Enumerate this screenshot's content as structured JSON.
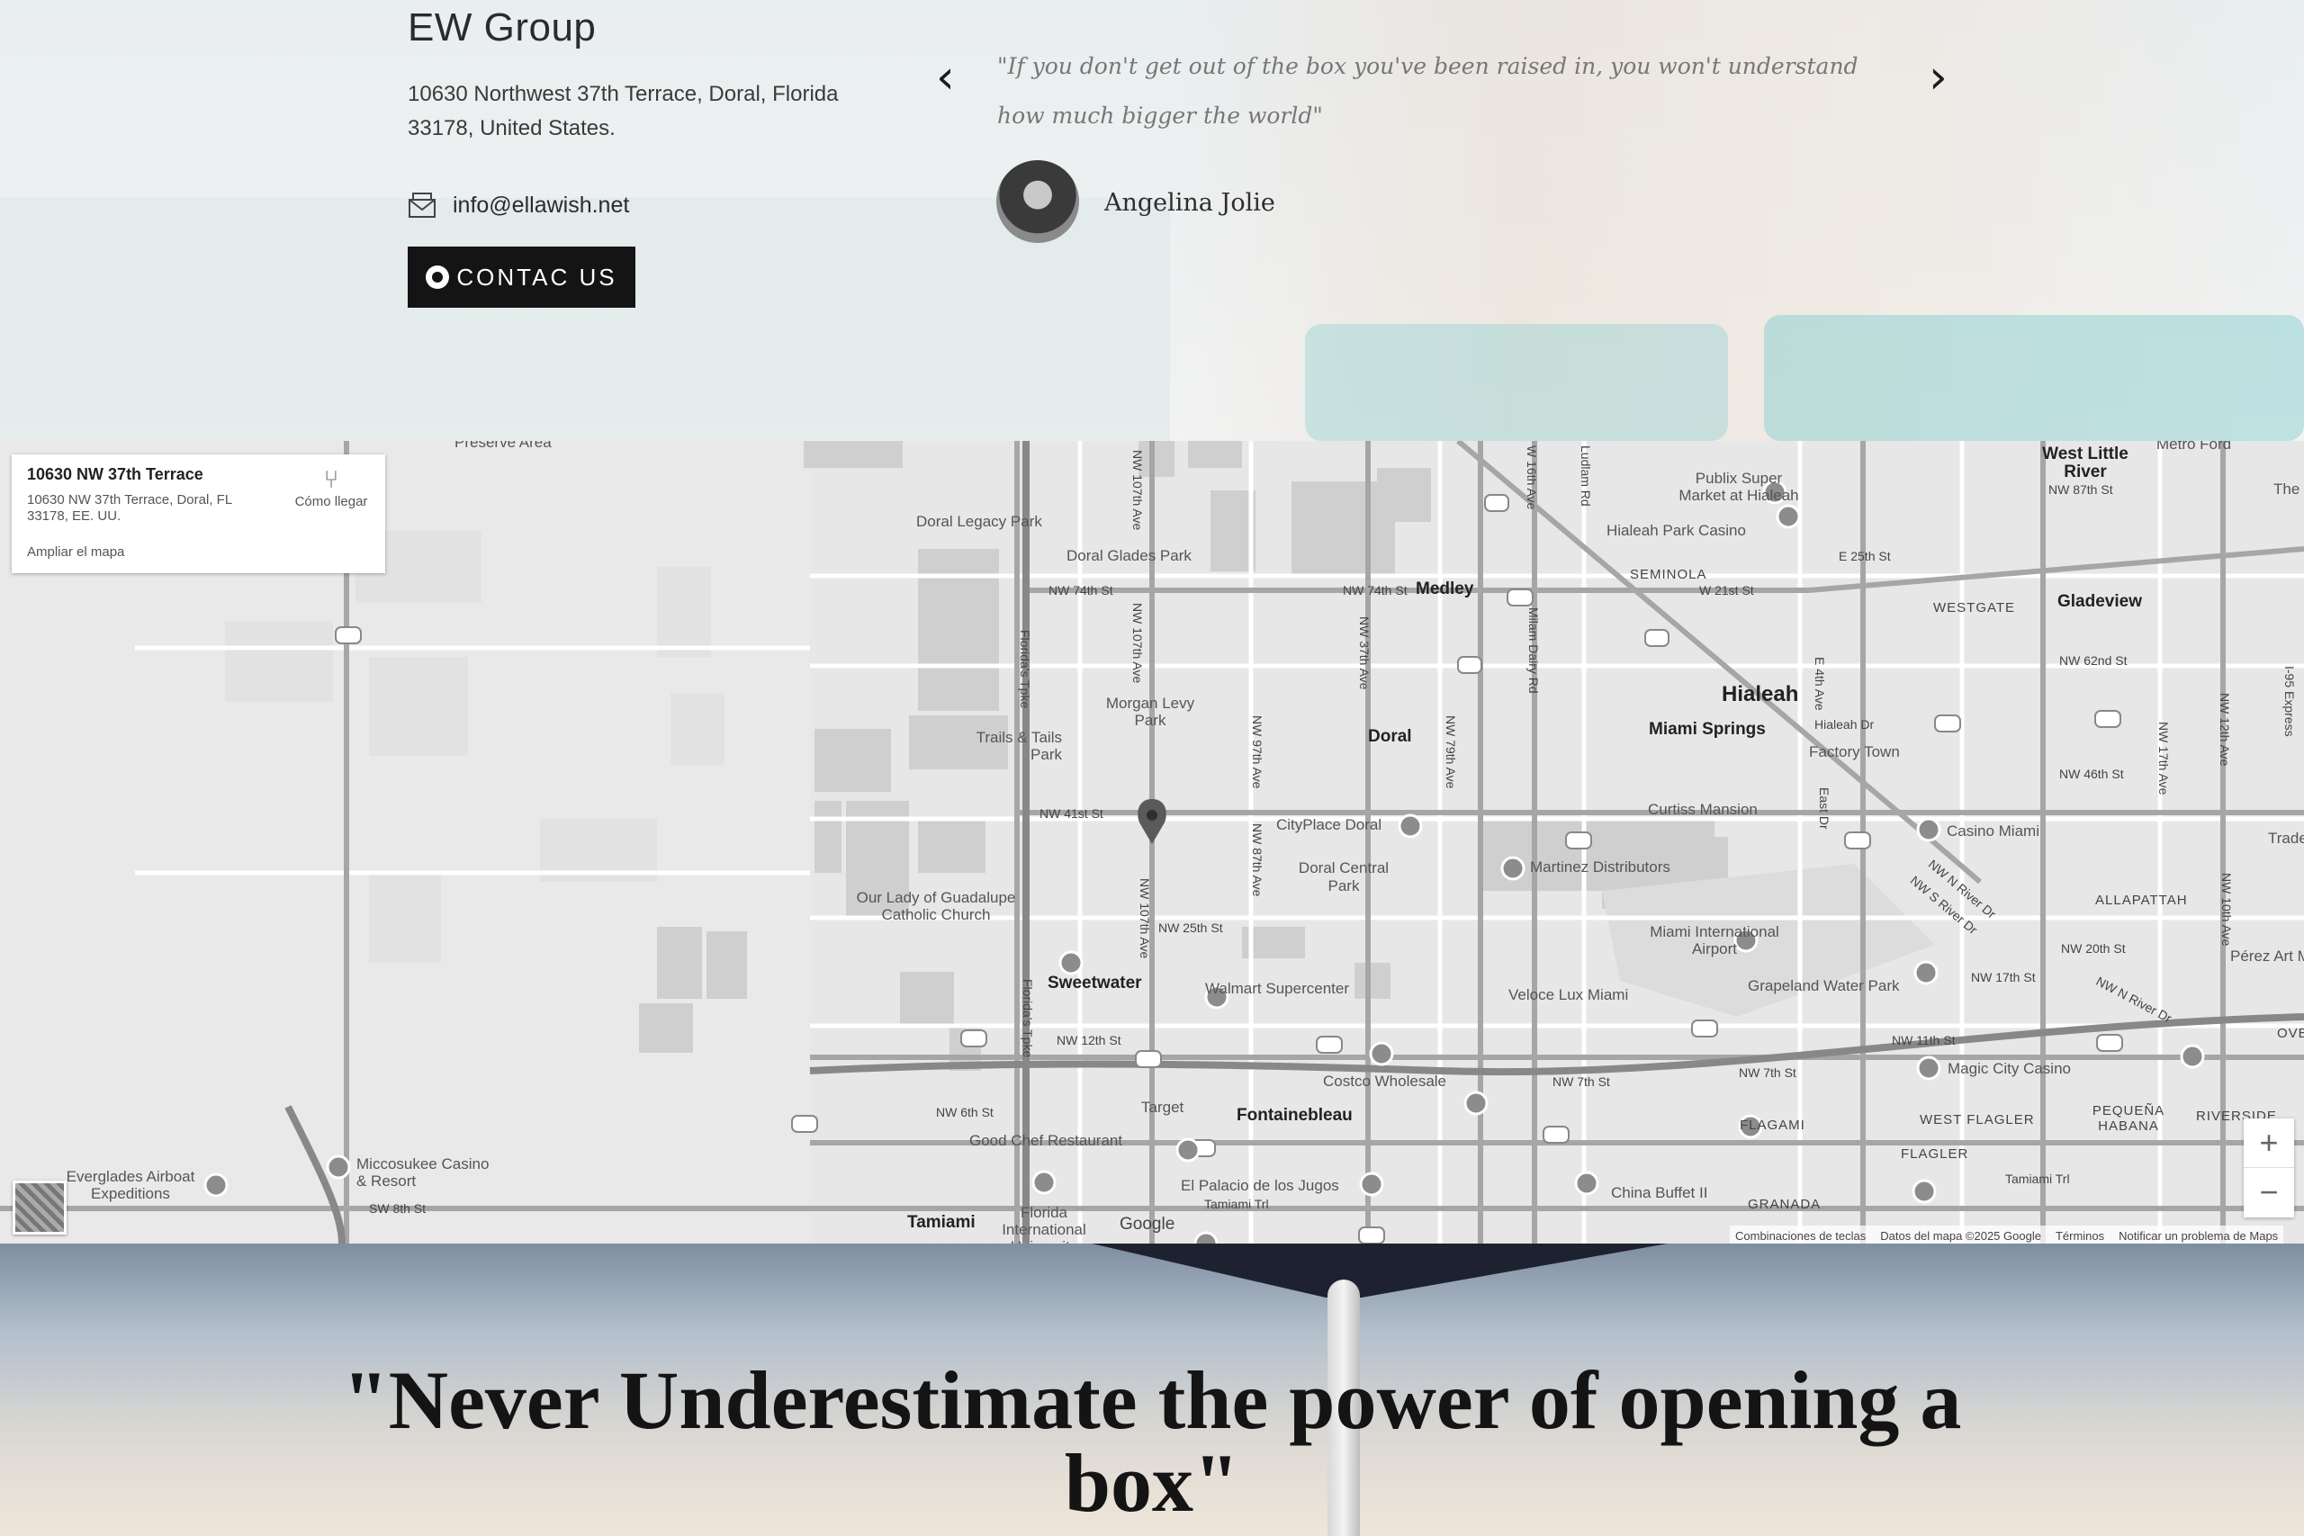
{
  "contact": {
    "company": "EW Group",
    "address": "10630 Northwest 37th Terrace, Doral, Florida 33178, United States.",
    "email": "info@ellawish.net",
    "cta_label": "CONTAC US"
  },
  "testimonial": {
    "quote": "\"If you don't get out of the box you've been raised in, you won't understand how much bigger the world\"",
    "author": "Angelina Jolie"
  },
  "map": {
    "card": {
      "title": "10630 NW 37th Terrace",
      "address": "10630 NW 37th Terrace, Doral, FL 33178, EE. UU.",
      "directions": "Cómo llegar",
      "enlarge": "Ampliar el mapa"
    },
    "labels": {
      "doral_legacy_park": "Doral Legacy Park",
      "doral_glades_park": "Doral Glades Park",
      "nw_74th_st": "NW 74th St",
      "nw_74th_st_2": "NW 74th St",
      "medley": "Medley",
      "publix": "Publix Super Market at Hialeah",
      "hialeah_park_casino": "Hialeah Park Casino",
      "seminola": "SEMINOLA",
      "w_21st_st": "W 21st St",
      "e_25th_st": "E 25th St",
      "westgate": "WESTGATE",
      "gladeview": "Gladeview",
      "west_little_river": "West Little River",
      "nw_87th_st": "NW 87th St",
      "nw_62nd_st": "NW 62nd St",
      "hialeah": "Hialeah",
      "miami_springs": "Miami Springs",
      "hialeah_dr": "Hialeah Dr",
      "factory_town": "Factory Town",
      "nw_46th_st": "NW 46th St",
      "morgan_levy_park": "Morgan Levy Park",
      "trails_tails_park": "Trails & Tails Park",
      "doral": "Doral",
      "nw_41st_st": "NW 41st St",
      "cityplace_doral": "CityPlace Doral",
      "curtiss_mansion": "Curtiss Mansion",
      "casino_miami": "Casino Miami",
      "doral_central_park": "Doral Central Park",
      "martinez_distributors": "Martinez Distributors",
      "our_lady": "Our Lady of Guadalupe Catholic Church",
      "nw_25th_st": "NW 25th St",
      "miami_international_airport": "Miami International Airport",
      "allapattah": "ALLAPATTAH",
      "nw_20th_st": "NW 20th St",
      "sweetwater": "Sweetwater",
      "walmart": "Walmart Supercenter",
      "veloce": "Veloce Lux Miami",
      "grapeland": "Grapeland Water Park",
      "nw_17th_st": "NW 17th St",
      "nw_12th_st": "NW 12th St",
      "nw_11th_st": "NW 11th St",
      "nw_7th_st": "NW 7th St",
      "nw_7th_st_2": "NW 7th St",
      "magic_city": "Magic City Casino",
      "costco": "Costco Wholesale",
      "nw_6th_st": "NW 6th St",
      "target": "Target",
      "fontainebleau": "Fontainebleau",
      "good_chef": "Good Chef Restaurant",
      "flagami": "FLAGAMI",
      "west_flagler": "WEST FLAGLER",
      "pequena_habana": "PEQUEÑA HABANA",
      "riverside": "RIVERSIDE",
      "flagler": "FLAGLER",
      "miccosukee": "Miccosukee Casino & Resort",
      "everglades": "Everglades Airboat Expeditions",
      "sw_8th_st": "SW 8th St",
      "tamiami": "Tamiami",
      "fiu": "Florida International University",
      "el_palacio": "El Palacio de los Jugos",
      "tamiami_trl": "Tamiami Trl",
      "china_buffet": "China Buffet II",
      "granada": "GRANADA",
      "preserve_area": "Preserve Area",
      "perez_art": "Pérez Art M",
      "metro_ford": "Metro Ford",
      "the": "The",
      "ove": "OVE",
      "trade": "Trade",
      "nw_107th_ave": "NW 107th Ave",
      "nw_107th_ave_2": "NW 107th Ave",
      "nw_107th_ave_3": "NW 107th Ave",
      "nw_97th_ave": "NW 97th Ave",
      "nw_87th_ave": "NW 87th Ave",
      "nw_79th_ave": "NW 79th Ave",
      "nw_37th_ave": "NW 37th Ave",
      "w_16th_ave": "W 16th Ave",
      "ludlam_rd": "Ludlam Rd",
      "milam_dairy_rd": "Milam Dairy Rd",
      "florida_tpke": "Florida's Tpke",
      "florida_tpke_2": "Florida's Tpke",
      "e_4th_ave": "E 4th Ave",
      "east_dr": "East Dr",
      "nw_17th_ave": "NW 17th Ave",
      "nw_12th_ave": "NW 12th Ave",
      "nw_10th_ave": "NW 10th Ave",
      "i95_express": "I-95 Express",
      "nw_s_river_dr": "NW S River Dr",
      "nw_n_river_dr": "NW N River Dr",
      "nw_river_dr": "NW N River Dr",
      "google": "Google"
    },
    "footer": [
      "Combinaciones de teclas",
      "Datos del mapa ©2025 Google",
      "Términos",
      "Notificar un problema de Maps"
    ],
    "zoom_in": "+",
    "zoom_out": "−"
  },
  "banner": {
    "headline": "\"Never Underestimate the power of opening a box\""
  },
  "icons": {
    "prev": "chevron-left-icon",
    "next": "chevron-right-icon",
    "email": "envelope-icon",
    "whatsapp": "whatsapp-icon",
    "marker": "map-pin-icon",
    "directions": "directions-icon"
  },
  "colors": {
    "cta_bg": "#141414",
    "map_bg": "#e7e7e7",
    "road": "#ffffff",
    "highway": "#9a9a9a",
    "text_dark": "#141414"
  }
}
